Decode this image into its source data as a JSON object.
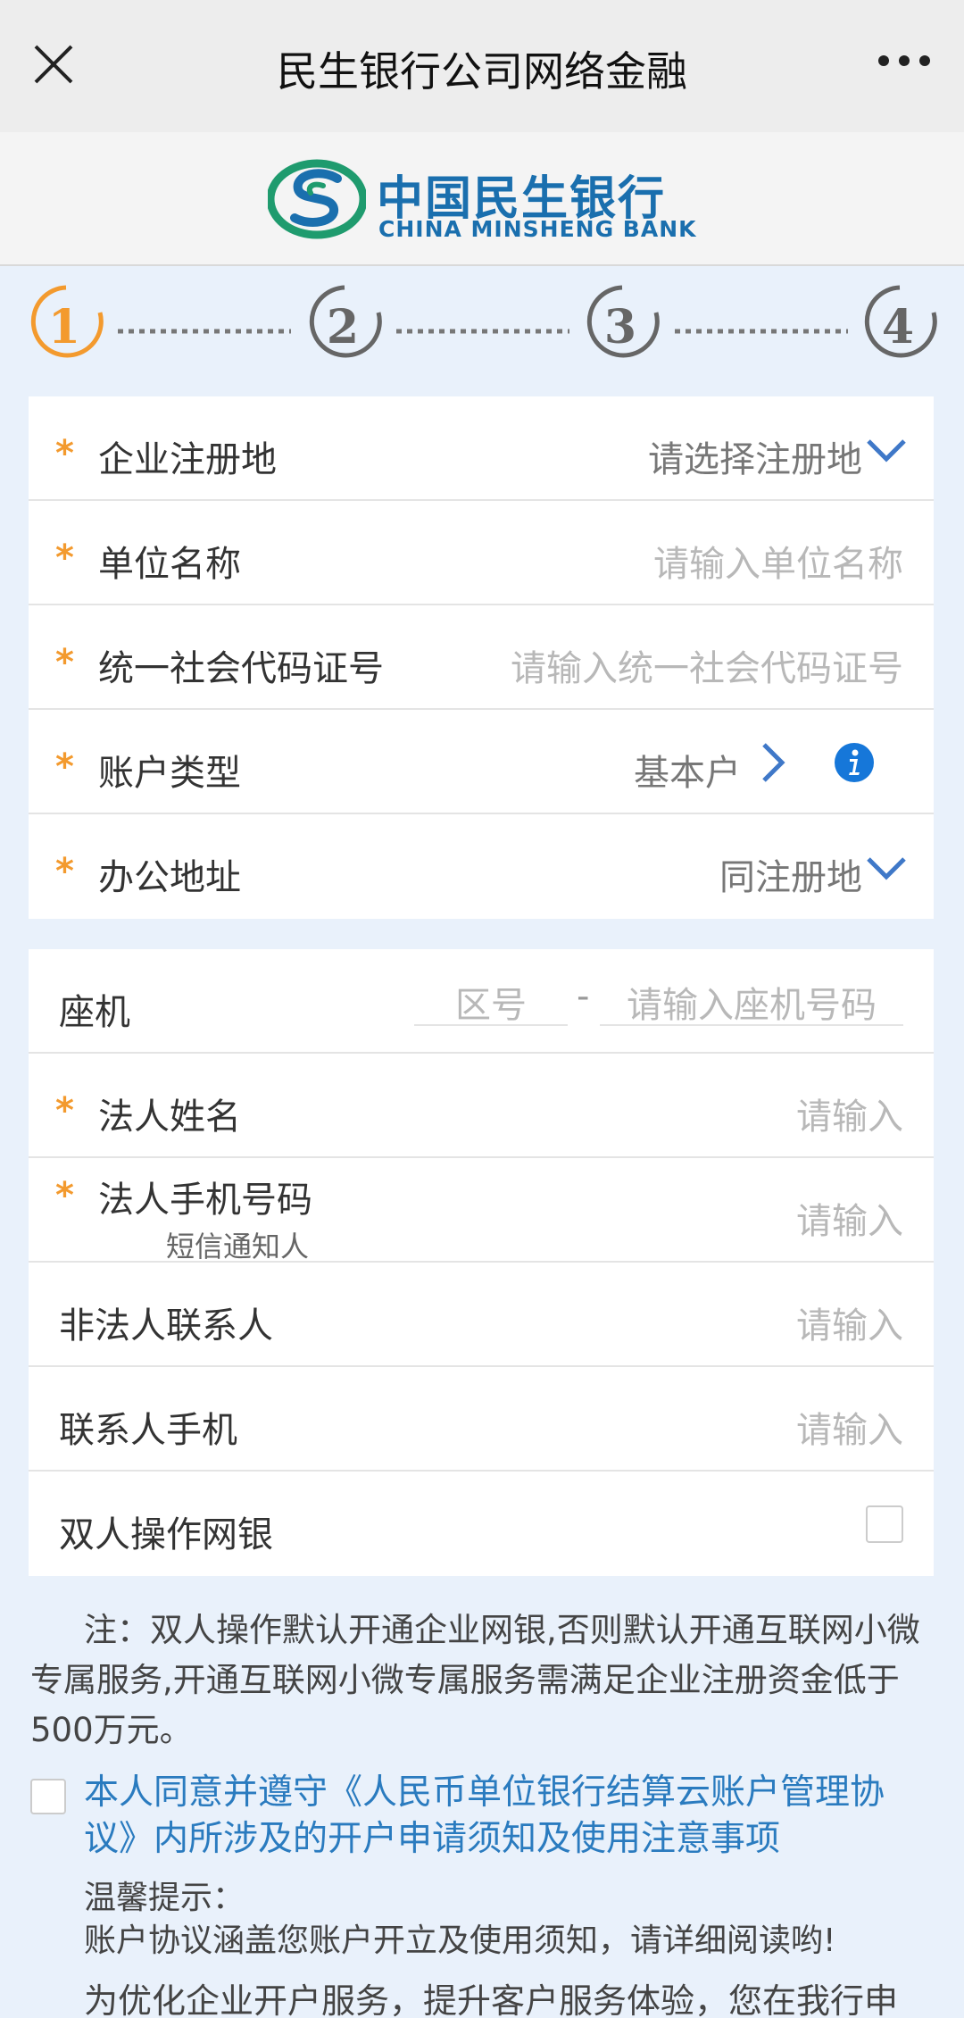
{
  "header": {
    "title": "民生银行公司网络金融",
    "close_icon": "close-icon",
    "more_icon": "more-icon"
  },
  "logo": {
    "cn": "中国民生银行",
    "en": "CHINA MINSHENG BANK"
  },
  "steps": {
    "items": [
      "1",
      "2",
      "3",
      "4"
    ],
    "active_index": 0,
    "active_color": "#f39a2e",
    "inactive_color": "#666666"
  },
  "form1": {
    "reg_place": {
      "label": "企业注册地",
      "value": "请选择注册地",
      "required": true
    },
    "org_name": {
      "label": "单位名称",
      "placeholder": "请输入单位名称",
      "required": true
    },
    "credit_code": {
      "label": "统一社会代码证号",
      "placeholder": "请输入统一社会代码证号",
      "required": true
    },
    "account_type": {
      "label": "账户类型",
      "value": "基本户",
      "required": true
    },
    "office_addr": {
      "label": "办公地址",
      "value": "同注册地",
      "required": true
    }
  },
  "form2": {
    "landline": {
      "label": "座机",
      "zone_placeholder": "区号",
      "separator": "-",
      "phone_placeholder": "请输入座机号码"
    },
    "legal_name": {
      "label": "法人姓名",
      "placeholder": "请输入",
      "required": true
    },
    "legal_mobile": {
      "label": "法人手机号码",
      "sub": "短信通知人",
      "placeholder": "请输入",
      "required": true
    },
    "contact": {
      "label": "非法人联系人",
      "placeholder": "请输入"
    },
    "contact_mobile": {
      "label": "联系人手机",
      "placeholder": "请输入"
    },
    "dual_op": {
      "label": "双人操作网银",
      "checked": false
    }
  },
  "note": "注：双人操作默认开通企业网银,否则默认开通互联网小微专属服务,开通互联网小微专属服务需满足企业注册资金低于500万元。",
  "agreement": {
    "checked": false,
    "text": "本人同意并遵守《人民币单位银行结算云账户管理协议》内所涉及的开户申请须知及使用注意事项"
  },
  "tips": {
    "title": "温馨提示：",
    "text": "账户协议涵盖您账户开立及使用须知，请详细阅读哟!"
  },
  "bottom_text": "为优化企业开户服务，提升客户服务体验，您在我行申",
  "colors": {
    "accent_orange": "#f39a2e",
    "link_blue": "#2a7bbf",
    "bank_blue": "#1a6fae",
    "info_blue": "#1677d9",
    "bank_green": "#1f9b6e"
  }
}
